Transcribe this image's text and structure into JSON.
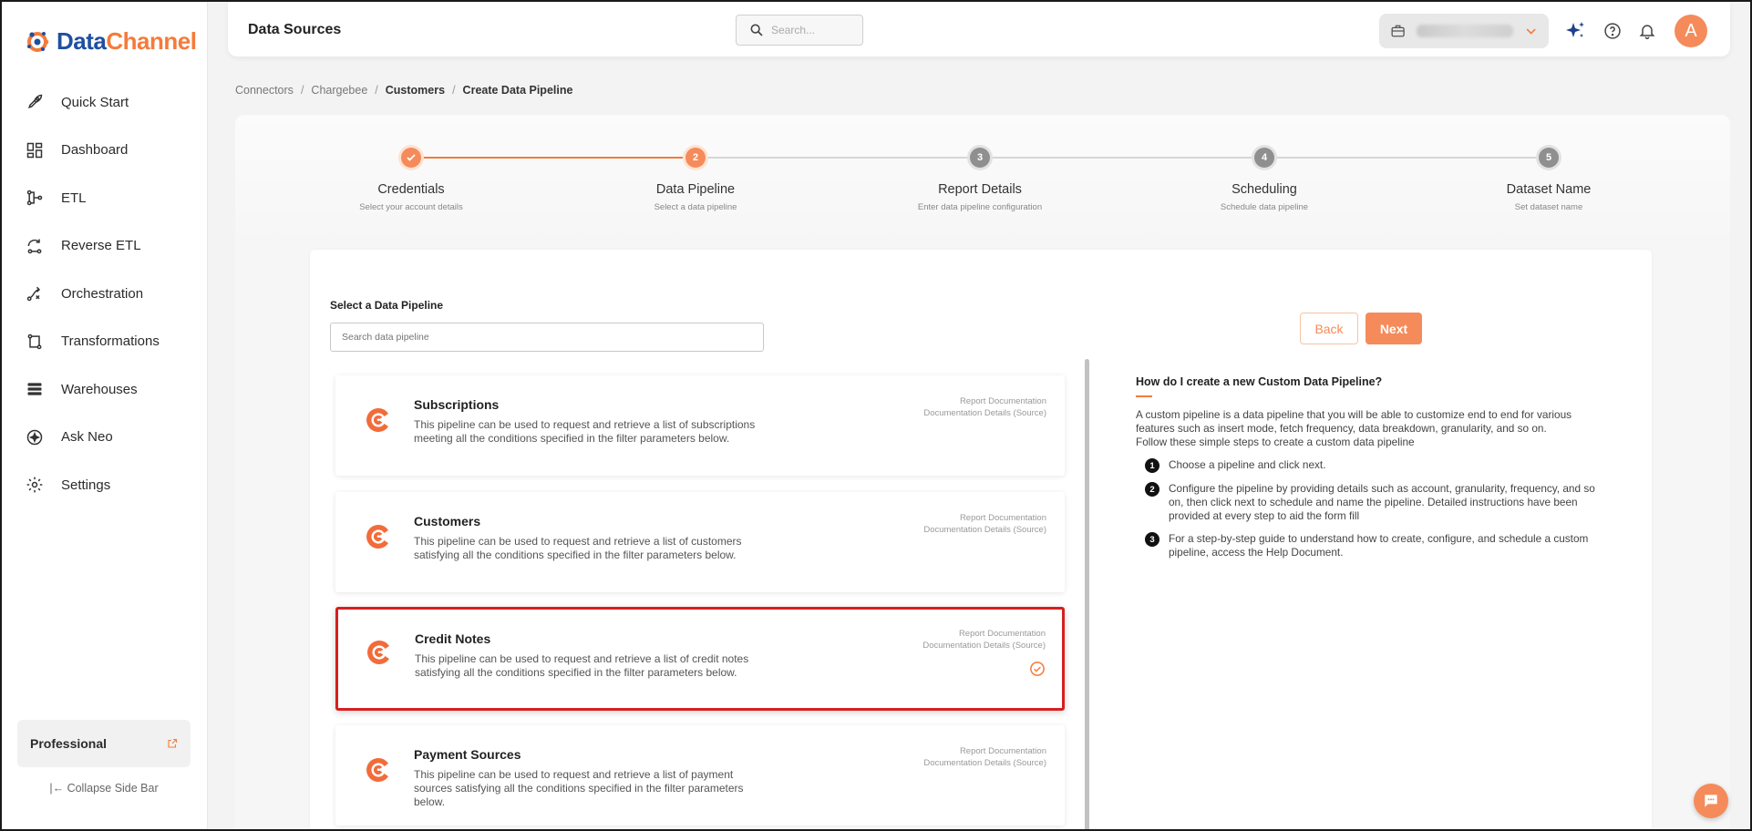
{
  "brand": {
    "name_part1": "Data",
    "name_part2": "Channel"
  },
  "sidebar": {
    "items": [
      {
        "label": "Quick Start",
        "icon": "rocket-icon"
      },
      {
        "label": "Dashboard",
        "icon": "dashboard-icon"
      },
      {
        "label": "ETL",
        "icon": "etl-icon"
      },
      {
        "label": "Reverse ETL",
        "icon": "reverse-etl-icon"
      },
      {
        "label": "Orchestration",
        "icon": "orchestration-icon"
      },
      {
        "label": "Transformations",
        "icon": "transformations-icon"
      },
      {
        "label": "Warehouses",
        "icon": "warehouse-icon"
      },
      {
        "label": "Ask Neo",
        "icon": "sparkle-icon"
      },
      {
        "label": "Settings",
        "icon": "gear-icon"
      }
    ],
    "plan_label": "Professional",
    "collapse_label": "Collapse Side Bar"
  },
  "header": {
    "title": "Data Sources",
    "search_placeholder": "Search...",
    "avatar_letter": "A"
  },
  "breadcrumb": [
    "Connectors",
    "Chargebee",
    "Customers",
    "Create Data Pipeline"
  ],
  "stepper": {
    "steps": [
      {
        "label": "Credentials",
        "sub": "Select your account details",
        "number": "1",
        "state": "done"
      },
      {
        "label": "Data Pipeline",
        "sub": "Select a data pipeline",
        "number": "2",
        "state": "active"
      },
      {
        "label": "Report Details",
        "sub": "Enter data pipeline configuration",
        "number": "3",
        "state": "pending"
      },
      {
        "label": "Scheduling",
        "sub": "Schedule data pipeline",
        "number": "4",
        "state": "pending"
      },
      {
        "label": "Dataset Name",
        "sub": "Set dataset name",
        "number": "5",
        "state": "pending"
      }
    ]
  },
  "pipeline": {
    "section_label": "Select a Data Pipeline",
    "search_placeholder": "Search data pipeline",
    "back_label": "Back",
    "next_label": "Next",
    "link_report": "Report Documentation",
    "link_details": "Documentation Details (Source)",
    "items": [
      {
        "title": "Subscriptions",
        "description": "This pipeline can be used to request and retrieve a list of subscriptions meeting all the conditions specified in the filter parameters below.",
        "selected": false
      },
      {
        "title": "Customers",
        "description": "This pipeline can be used to request and retrieve a list of customers satisfying all the conditions specified in the filter parameters below.",
        "selected": false
      },
      {
        "title": "Credit Notes",
        "description": "This pipeline can be used to request and retrieve a list of credit notes satisfying all the conditions specified in the filter parameters below.",
        "selected": true
      },
      {
        "title": "Payment Sources",
        "description": "This pipeline can be used to request and retrieve a list of payment sources satisfying all the conditions specified in the filter parameters below.",
        "selected": false
      }
    ]
  },
  "help": {
    "title": "How do I create a new Custom Data Pipeline?",
    "intro1": "A custom pipeline is a data pipeline that you will be able to customize end to end for various features such as insert mode, fetch frequency, data breakdown, granularity, and so on.",
    "intro2": "Follow these simple steps to create a custom data pipeline",
    "steps": [
      {
        "num": "1",
        "text": "Choose a pipeline and click next."
      },
      {
        "num": "2",
        "text": "Configure the pipeline by providing details such as account, granularity, frequency, and so on, then click next to schedule and name the pipeline. Detailed instructions have been provided at every step to aid the form fill"
      },
      {
        "num": "3",
        "text": "For a step-by-step guide to understand how to create, configure, and schedule a custom pipeline, access the Help Document."
      }
    ]
  },
  "colors": {
    "accent": "#f58b5a",
    "brand_blue": "#1f4fa0",
    "selected_border": "#d61f1f"
  }
}
